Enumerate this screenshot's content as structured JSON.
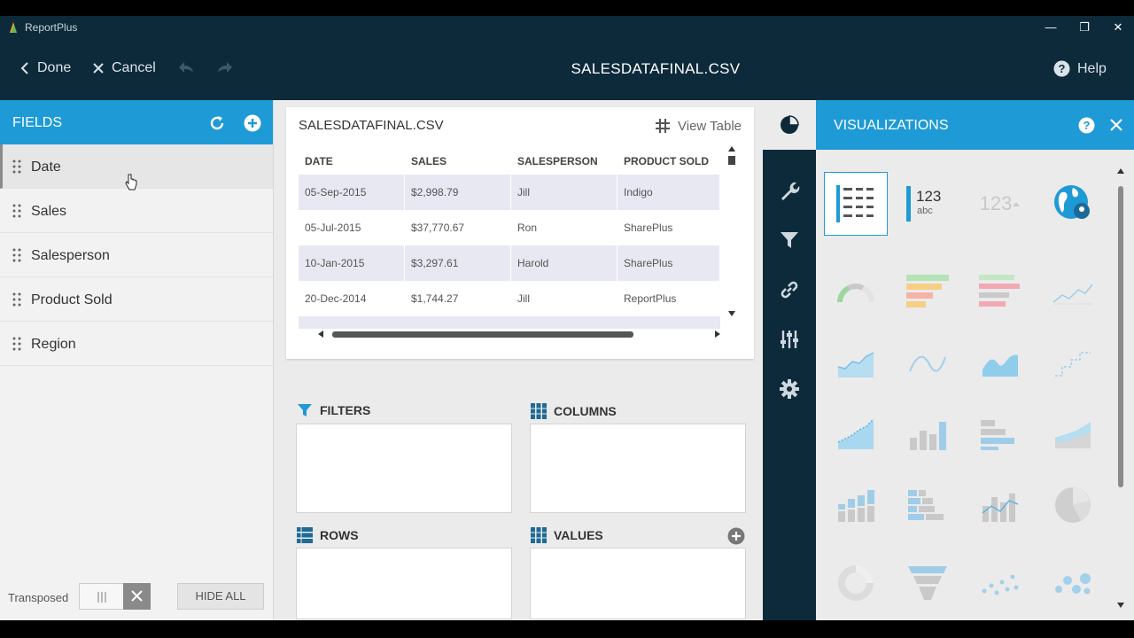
{
  "window": {
    "app_title": "ReportPlus",
    "minimize": "—",
    "restore": "❐",
    "close": "✕"
  },
  "toolbar": {
    "done_label": "Done",
    "cancel_label": "Cancel",
    "title": "SALESDATAFINAL.CSV",
    "help_label": "Help"
  },
  "fields": {
    "header": "FIELDS",
    "items": [
      {
        "label": "Date"
      },
      {
        "label": "Sales"
      },
      {
        "label": "Salesperson"
      },
      {
        "label": "Product Sold"
      },
      {
        "label": "Region"
      }
    ],
    "transposed_label": "Transposed",
    "hide_all_label": "HIDE ALL"
  },
  "preview": {
    "title": "SALESDATAFINAL.CSV",
    "view_table_label": "View Table",
    "columns": [
      "DATE",
      "SALES",
      "SALESPERSON",
      "PRODUCT SOLD"
    ],
    "rows": [
      [
        "05-Sep-2015",
        "$2,998.79",
        "Jill",
        "Indigo"
      ],
      [
        "05-Jul-2015",
        "$37,770.67",
        "Ron",
        "SharePlus"
      ],
      [
        "10-Jan-2015",
        "$3,297.61",
        "Harold",
        "SharePlus"
      ],
      [
        "20-Dec-2014",
        "$1,744.27",
        "Jill",
        "ReportPlus"
      ]
    ]
  },
  "zones": {
    "filters": "FILTERS",
    "columns": "COLUMNS",
    "rows": "ROWS",
    "values": "VALUES"
  },
  "visualizations": {
    "header": "VISUALIZATIONS",
    "kpi_number": "123",
    "kpi_text": "abc",
    "kpi_trend": "123"
  },
  "colors": {
    "accent": "#1e9ad6",
    "dark": "#0d2a3b"
  }
}
